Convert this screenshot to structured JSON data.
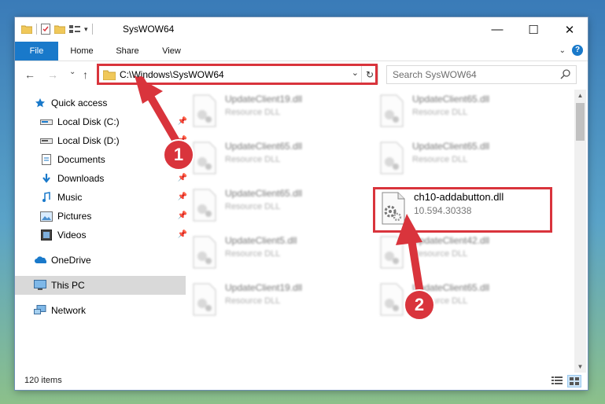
{
  "window": {
    "title": "SysWOW64",
    "caption": {
      "minimize": "—",
      "maximize": "☐",
      "close": "✕"
    }
  },
  "ribbon": {
    "file": "File",
    "home": "Home",
    "share": "Share",
    "view": "View",
    "help": "?"
  },
  "nav": {
    "back": "←",
    "forward": "→",
    "recent": "⌄",
    "up": "↑",
    "address": "C:\\Windows\\SysWOW64",
    "search_placeholder": "Search SysWOW64"
  },
  "sidebar": {
    "items": [
      {
        "label": "Quick access"
      },
      {
        "label": "Local Disk (C:)"
      },
      {
        "label": "Local Disk (D:)"
      },
      {
        "label": "Documents"
      },
      {
        "label": "Downloads"
      },
      {
        "label": "Music"
      },
      {
        "label": "Pictures"
      },
      {
        "label": "Videos"
      },
      {
        "label": "OneDrive"
      },
      {
        "label": "This PC"
      },
      {
        "label": "Network"
      }
    ]
  },
  "files": [
    {
      "name": "UpdateClient19.dll",
      "sub": "Resource DLL"
    },
    {
      "name": "UpdateClient65.dll",
      "sub": "Resource DLL"
    },
    {
      "name": "UpdateClient65.dll",
      "sub": "Resource DLL"
    },
    {
      "name": "UpdateClient65.dll",
      "sub": "Resource DLL"
    },
    {
      "name": "UpdateClient65.dll",
      "sub": "Resource DLL"
    },
    {
      "name": "ch10-addabutton.dll",
      "sub": "10.594.30338"
    },
    {
      "name": "UpdateClient5.dll",
      "sub": "Resource DLL"
    },
    {
      "name": "UpdateClient42.dll",
      "sub": "Resource DLL"
    },
    {
      "name": "UpdateClient19.dll",
      "sub": "Resource DLL"
    },
    {
      "name": "UpdateClient65.dll",
      "sub": "Resource DLL"
    }
  ],
  "status": {
    "count": "120 items"
  },
  "markers": {
    "one": "1",
    "two": "2"
  },
  "colors": {
    "accent": "#1979ca",
    "highlight": "#d9343c",
    "selected": "#d9d9d9"
  }
}
